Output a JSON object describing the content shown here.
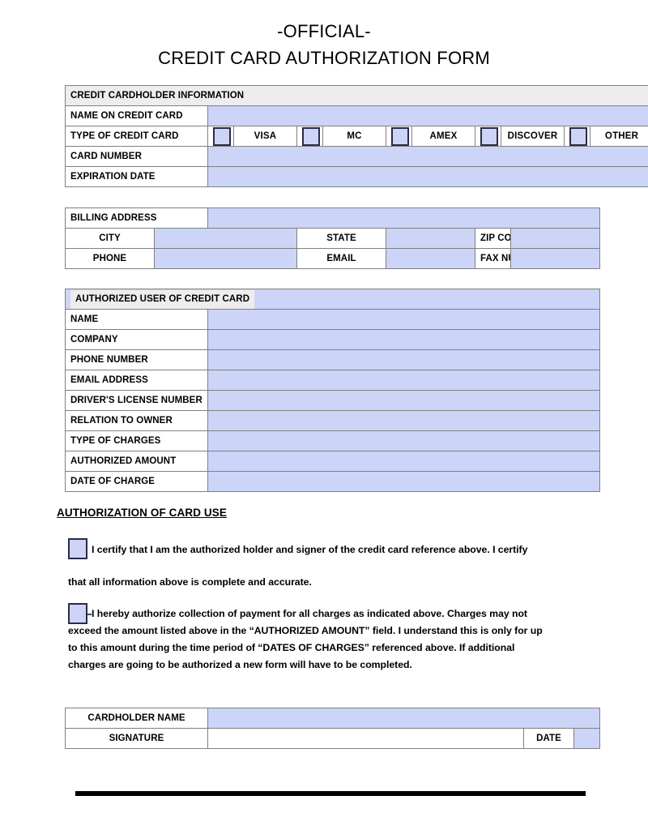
{
  "document": {
    "title_line1": "-OFFICIAL-",
    "title_line2": "CREDIT CARD AUTHORIZATION FORM"
  },
  "colors": {
    "field_fill": "#ccd4f7",
    "section_header": "#ededed",
    "border": "#808080",
    "checkbox_border": "#2b2b45",
    "rule": "#000000"
  },
  "cardholder_section": {
    "header": "CREDIT CARDHOLDER INFORMATION",
    "rows": [
      {
        "label": "NAME  ON  CREDIT CARD",
        "value": ""
      },
      {
        "label": "TYPE OF  CREDIT CARD",
        "value": ""
      },
      {
        "label": "CARD NUMBER",
        "value": ""
      },
      {
        "label": "EXPIRATION DATE",
        "value": ""
      }
    ],
    "card_types": [
      {
        "name": "VISA",
        "checked": false
      },
      {
        "name": "MC",
        "checked": false
      },
      {
        "name": "AMEX",
        "checked": false
      },
      {
        "name": "DISCOVER",
        "checked": false
      },
      {
        "name": "OTHER",
        "checked": false
      }
    ]
  },
  "billing_section": {
    "header": "BILLING ADDRESS",
    "header_value": "",
    "row1": [
      {
        "label": "CITY",
        "value": ""
      },
      {
        "label": "STATE",
        "value": ""
      },
      {
        "label": "ZIP CODE",
        "value": ""
      }
    ],
    "row2": [
      {
        "label": "PHONE",
        "value": ""
      },
      {
        "label": "EMAIL",
        "value": ""
      },
      {
        "label": "FAX NUMBER",
        "value": ""
      }
    ]
  },
  "authorized_user_section": {
    "header": "AUTHORIZED USER OF CREDIT CARD",
    "rows": [
      {
        "label": "NAME",
        "value": ""
      },
      {
        "label": "COMPANY",
        "value": ""
      },
      {
        "label": "PHONE NUMBER",
        "value": ""
      },
      {
        "label": "EMAIL ADDRESS",
        "value": ""
      },
      {
        "label": "DRIVER'S LICENSE NUMBER",
        "value": ""
      },
      {
        "label": "RELATION TO OWNER",
        "value": ""
      },
      {
        "label": "TYPE OF  CHARGES",
        "value": ""
      },
      {
        "label": "AUTHORIZED AMOUNT",
        "value": ""
      },
      {
        "label": "DATE OF CHARGE",
        "value": ""
      }
    ]
  },
  "authorization_section": {
    "heading": "AUTHORIZATION OF CARD USE",
    "clause1": {
      "checked": false,
      "line1": "I certify that I am the authorized holder and signer of the credit card reference above. I certify",
      "line2": "that all information above is complete and accurate."
    },
    "clause2": {
      "checked": false,
      "line1": "I hereby authorize collection of payment for all charges as indicated above. Charges may not",
      "line2": "exceed the amount listed above in the “AUTHORIZED AMOUNT” field.  I understand this is only for up",
      "line3": "to this amount during the time period of “DATES OF CHARGES” referenced above. If additional",
      "line4": "charges are going to be authorized a new form will have to be completed."
    }
  },
  "signature_section": {
    "rows": [
      {
        "label": "CARDHOLDER NAME",
        "value": ""
      },
      {
        "label": "SIGNATURE",
        "value": "",
        "date_label": "DATE",
        "date_value": ""
      }
    ]
  }
}
